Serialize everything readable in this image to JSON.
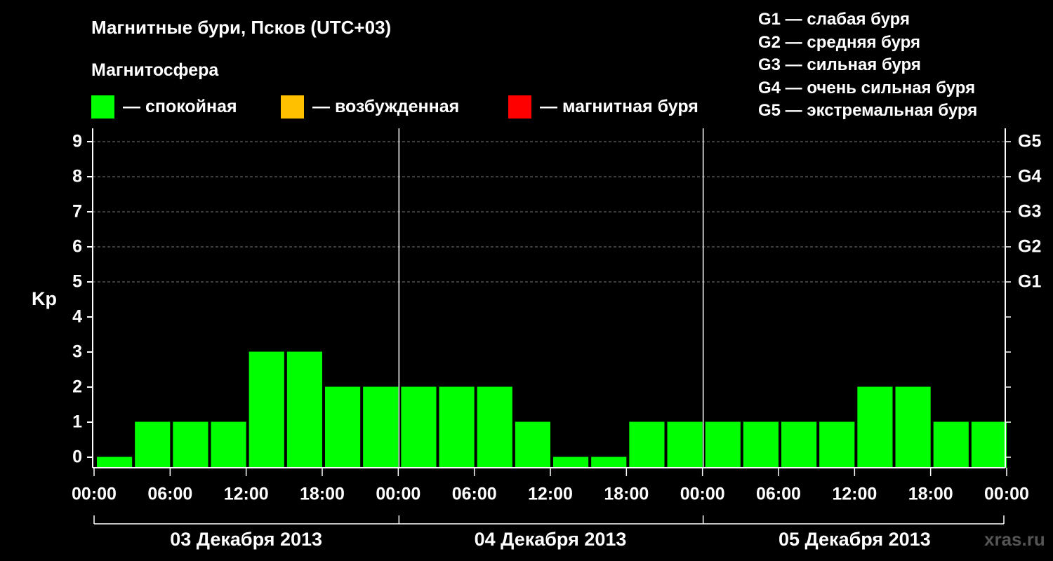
{
  "header": {
    "title": "Магнитные бури, Псков (UTC+03)",
    "subtitle": "Магнитосфера"
  },
  "legend": [
    {
      "label": "— спокойная",
      "color": "#00ff00"
    },
    {
      "label": "— возбужденная",
      "color": "#ffc000"
    },
    {
      "label": "— магнитная буря",
      "color": "#ff0000"
    }
  ],
  "storm_legend": [
    "G1 — слабая буря",
    "G2 — средняя буря",
    "G3 — сильная буря",
    "G4 — очень сильная буря",
    "G5 — экстремальная буря"
  ],
  "watermark": "xras.ru",
  "chart_data": {
    "type": "bar",
    "ylabel": "Kp",
    "ylim": [
      0,
      9
    ],
    "y_ticks": [
      0,
      1,
      2,
      3,
      4,
      5,
      6,
      7,
      8,
      9
    ],
    "right_axis_labels": [
      {
        "kp": 5,
        "label": "G1"
      },
      {
        "kp": 6,
        "label": "G2"
      },
      {
        "kp": 7,
        "label": "G3"
      },
      {
        "kp": 8,
        "label": "G4"
      },
      {
        "kp": 9,
        "label": "G5"
      }
    ],
    "x_tick_labels": [
      "00:00",
      "06:00",
      "12:00",
      "18:00",
      "00:00",
      "06:00",
      "12:00",
      "18:00",
      "00:00",
      "06:00",
      "12:00",
      "18:00",
      "00:00"
    ],
    "days": [
      "03 Декабря 2013",
      "04 Декабря 2013",
      "05 Декабря 2013"
    ],
    "interval_hours": 3,
    "values": [
      0,
      1,
      1,
      1,
      3,
      3,
      2,
      2,
      2,
      2,
      2,
      1,
      0,
      0,
      1,
      1,
      1,
      1,
      1,
      1,
      2,
      2,
      1,
      1
    ],
    "bar_color": "#00ff00",
    "grid": true
  }
}
